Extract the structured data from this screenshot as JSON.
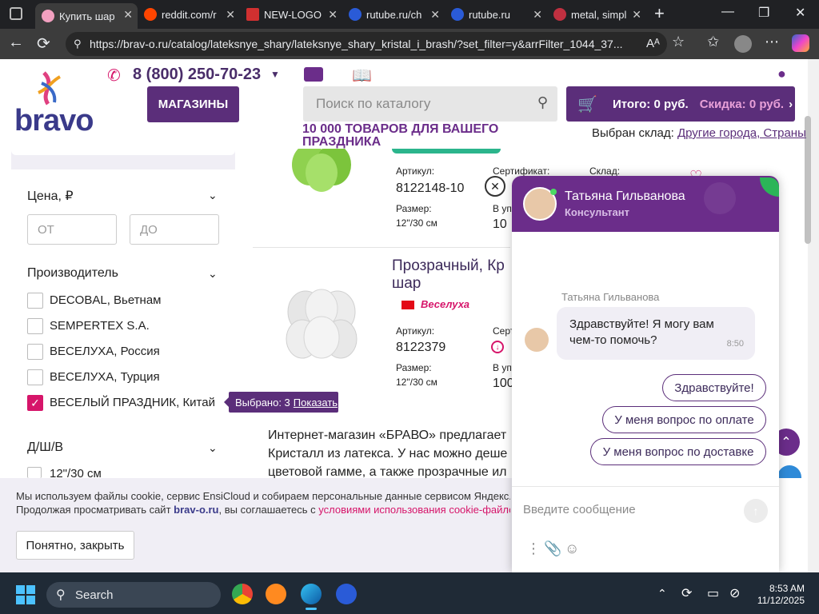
{
  "browser": {
    "tabs": [
      {
        "label": "Купить шар",
        "active": true,
        "color": "#f2a0c0"
      },
      {
        "label": "reddit.com/r",
        "active": false,
        "color": "#ff4500"
      },
      {
        "label": "NEW-LOGO",
        "active": false,
        "color": "#d03030"
      },
      {
        "label": "rutube.ru/ch",
        "active": false,
        "color": "#2a5bd7"
      },
      {
        "label": "rutube.ru",
        "active": false,
        "color": "#2a5bd7"
      },
      {
        "label": "metal, simpl",
        "active": false,
        "color": "#c03040"
      }
    ],
    "url": "https://brav-o.ru/catalog/lateksnye_shary/lateksnye_shary_kristal_i_brash/?set_filter=y&arrFilter_1044_37..."
  },
  "header": {
    "logo": "bravo",
    "phone": "8 (800) 250-70-23",
    "stores_button": "МАГАЗИНЫ",
    "search_placeholder": "Поиск по каталогу",
    "cart_total": "Итого: 0 руб.",
    "cart_discount": "Скидка: 0 руб.",
    "promo": "10 000 ТОВАРОВ ДЛЯ ВАШЕГО ПРАЗДНИКА",
    "warehouse_label": "Выбран склад:",
    "warehouse_link": "Другие города, Страны"
  },
  "sidebar": {
    "price_title": "Цена, ₽",
    "from_placeholder": "ОТ",
    "to_placeholder": "ДО",
    "manufacturer_title": "Производитель",
    "manufacturers": [
      {
        "label": "DECOBAL, Вьетнам",
        "checked": false
      },
      {
        "label": "SEMPERTEX S.A.",
        "checked": false
      },
      {
        "label": "ВЕСЕЛУХА, Россия",
        "checked": false
      },
      {
        "label": "ВЕСЕЛУХА, Турция",
        "checked": false
      },
      {
        "label": "ВЕСЕЛЫЙ ПРАЗДНИК, Китай",
        "checked": true
      }
    ],
    "size_title": "Д/Ш/В",
    "size_option": "12\"/30 см",
    "tooltip_text": "Выбрано: 3",
    "tooltip_link": "Показать"
  },
  "products": [
    {
      "article_label": "Артикул:",
      "article": "8122148-10",
      "size_label": "Размер:",
      "size": "12\"/30 см",
      "cert_label": "Сертификат:",
      "pack_label": "В упа",
      "pack_value": "10",
      "stock_label": "Склад:"
    },
    {
      "title": "Прозрачный, Кр",
      "title2": "шар",
      "brand": "Веселуха",
      "article_label": "Артикул:",
      "article": "8122379",
      "size_label": "Размер:",
      "size": "12\"/30 см",
      "cert_label": "Серт",
      "pack_label": "В уп",
      "pack_value": "100"
    }
  ],
  "description": {
    "line1": "Интернет-магазин «БРАВО» предлагает",
    "line2": "Кристалл из латекса. У нас можно деше",
    "line3": "цветовой гамме, а также прозрачные ил"
  },
  "cookie": {
    "text_before": "Мы используем файлы cookie, сервис EnsiCloud и собираем персональные данные сервисом Яндекс.Метрика.",
    "text_line2": "Продолжая просматривать сайт",
    "site": "brav-o.ru",
    "text_line2b": ", вы соглашаетесь с",
    "link": "условиями использования cookie-файлов и поли",
    "button": "Понятно, закрыть"
  },
  "chat": {
    "agent_name": "Татьяна Гильванова",
    "agent_role": "Консультант",
    "sender": "Татьяна Гильванова",
    "message": "Здравствуйте! Я могу вам чем-то помочь?",
    "time": "8:50",
    "options": [
      "Здравствуйте!",
      "У меня вопрос по оплате",
      "У меня вопрос по доставке"
    ],
    "input_placeholder": "Введите сообщение"
  },
  "taskbar": {
    "search": "Search",
    "time": "8:53 AM",
    "date": "11/12/2025"
  },
  "colors": {
    "brand_purple": "#5b2e7a",
    "accent_pink": "#d6156a"
  }
}
